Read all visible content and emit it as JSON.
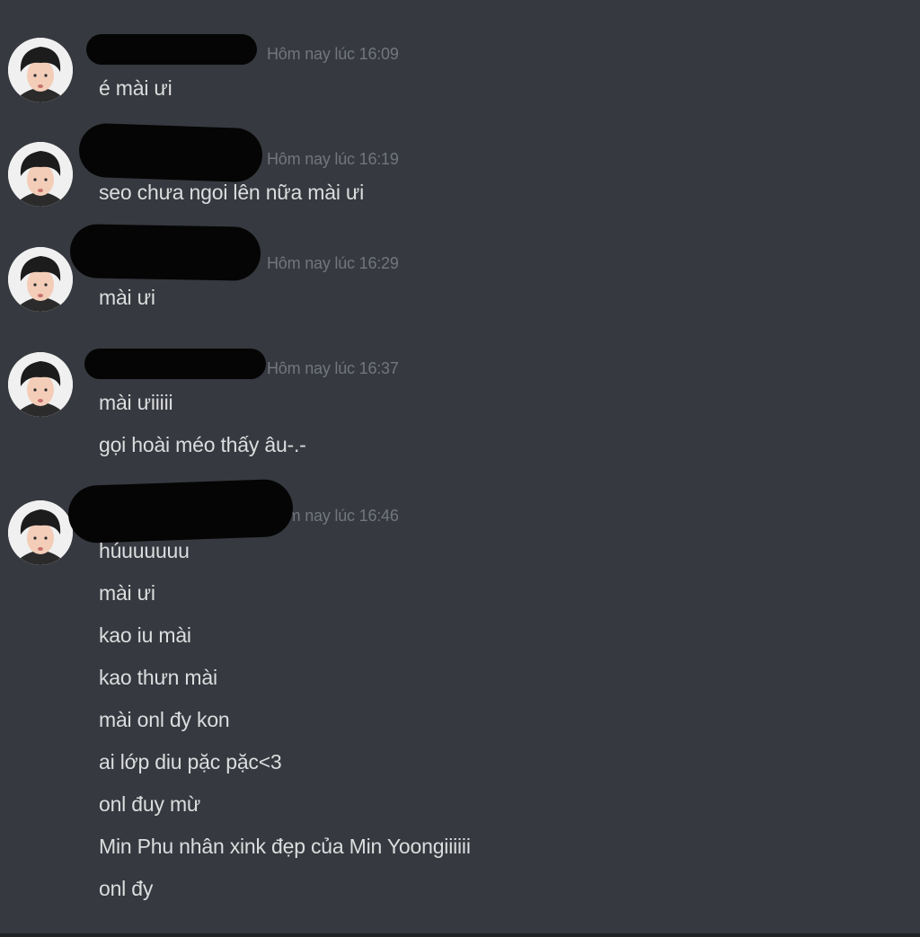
{
  "messages": [
    {
      "timestamp": "Hôm nay lúc 16:09",
      "lines": [
        "é mài ưi"
      ]
    },
    {
      "timestamp": "Hôm nay lúc 16:19",
      "lines": [
        "seo chưa ngoi lên nữa mài ưi"
      ]
    },
    {
      "timestamp": "Hôm nay lúc 16:29",
      "lines": [
        "mài ưi"
      ]
    },
    {
      "timestamp": "Hôm nay lúc 16:37",
      "lines": [
        "mài ưiiiii",
        "gọi hoài méo thấy âu-.-"
      ]
    },
    {
      "timestamp": "Hôm nay lúc 16:46",
      "lines": [
        "húuuuuuu",
        "mài ưi",
        "kao iu mài",
        "kao thưn mài",
        "mài onl đy kon",
        "ai lớp diu pặc pặc<3",
        "onl đuy mừ",
        "Min Phu nhân xink đẹp của Min Yoongiiiiii",
        "onl đy"
      ]
    }
  ],
  "colors": {
    "background": "#36393f",
    "message_text": "#dcddde",
    "timestamp_text": "#72767d"
  }
}
